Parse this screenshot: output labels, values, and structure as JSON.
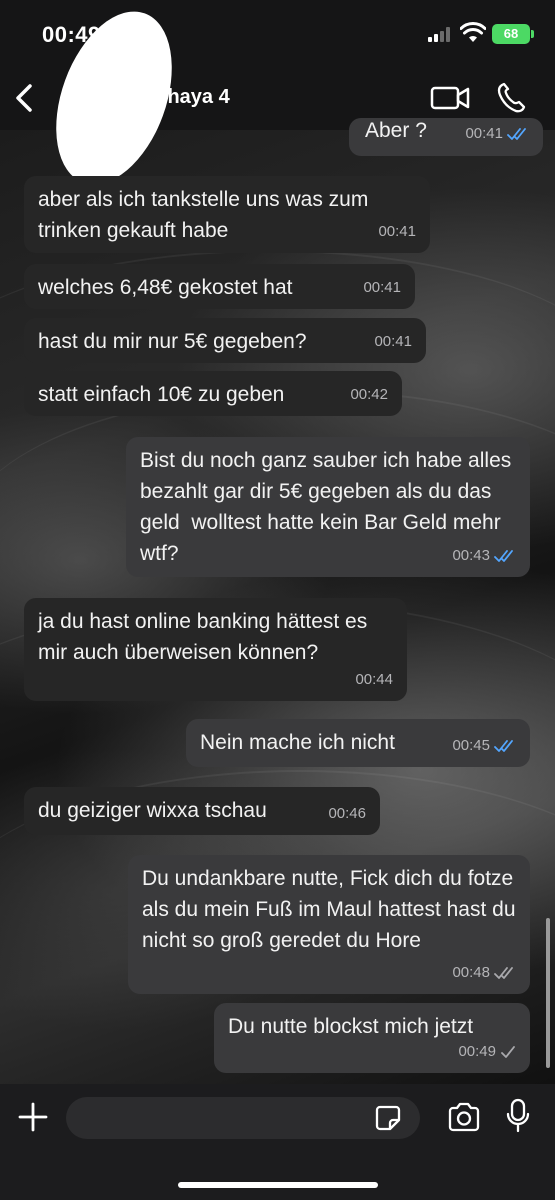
{
  "status_bar": {
    "time": "00:49",
    "battery": "68"
  },
  "header": {
    "contact_name": "Chaya 4"
  },
  "messages": [
    {
      "dir": "out",
      "text": "Aber ?",
      "time": "00:41",
      "receipt": "read"
    },
    {
      "dir": "in",
      "text": "aber als ich tankstelle uns was zum trinken gekauft habe",
      "time": "00:41"
    },
    {
      "dir": "in",
      "text": "welches 6,48€ gekostet hat",
      "time": "00:41"
    },
    {
      "dir": "in",
      "text": "hast du mir nur 5€ gegeben?",
      "time": "00:41"
    },
    {
      "dir": "in",
      "text": "statt einfach 10€ zu geben",
      "time": "00:42"
    },
    {
      "dir": "out",
      "text": "Bist du noch ganz sauber ich habe alles bezahlt gar dir 5€ gegeben als du das geld  wolltest hatte kein Bar Geld mehr wtf?",
      "time": "00:43",
      "receipt": "read"
    },
    {
      "dir": "in",
      "text": "ja du hast online banking hättest es mir auch überweisen können?",
      "time": "00:44"
    },
    {
      "dir": "out",
      "text": "Nein mache ich nicht",
      "time": "00:45",
      "receipt": "read"
    },
    {
      "dir": "in",
      "text": "du geiziger wixxa tschau",
      "time": "00:46"
    },
    {
      "dir": "out",
      "text": "Du undankbare nutte, Fick dich du fotze als du mein Fuß im Maul hattest hast du nicht so groß geredet du Hore",
      "time": "00:48",
      "receipt": "delivered"
    },
    {
      "dir": "out",
      "text": "Du nutte blockst mich jetzt",
      "time": "00:49",
      "receipt": "sent"
    }
  ],
  "composer": {
    "placeholder": ""
  },
  "colors": {
    "read_check": "#53a6ff",
    "grey_check": "#a9a9ad",
    "incoming_bubble": "#262626",
    "outgoing_bubble": "#3a3a3c"
  }
}
